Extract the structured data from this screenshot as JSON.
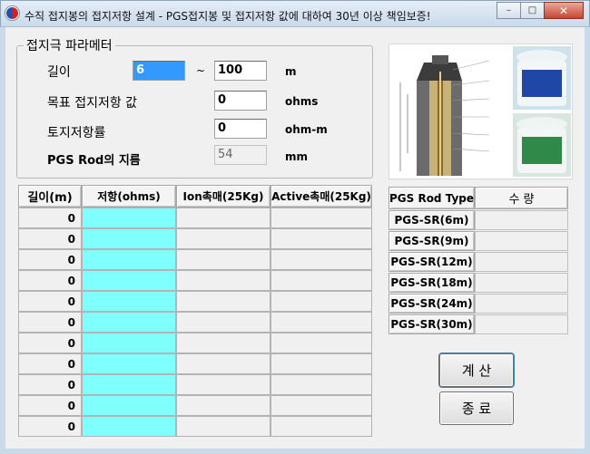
{
  "window": {
    "title": "수직 접지봉의 접지저항 설계 - PGS접지봉 및 접지저항 값에 대하여 30년 이상 책임보증!",
    "minimize": "–",
    "maximize": "□",
    "close": "✕"
  },
  "params": {
    "group_title": "접지극 파라메터",
    "depth_label": "길이",
    "depth_from": "6",
    "depth_sep": "~",
    "depth_to": "100",
    "depth_unit": "m",
    "target_label": "목표 접지저항 값",
    "target_value": "0",
    "target_unit": "ohms",
    "soil_label": "토지저항률",
    "soil_value": "0",
    "soil_unit": "ohm-m",
    "rod_diam_label": "PGS Rod의 지름",
    "rod_diam_value": "54",
    "rod_diam_unit": "mm"
  },
  "result_table": {
    "headers": [
      "길이(m)",
      "저항(ohms)",
      "Ion촉매(25Kg)",
      "Active촉매(25Kg)"
    ],
    "rows": [
      {
        "depth": "0"
      },
      {
        "depth": "0"
      },
      {
        "depth": "0"
      },
      {
        "depth": "0"
      },
      {
        "depth": "0"
      },
      {
        "depth": "0"
      },
      {
        "depth": "0"
      },
      {
        "depth": "0"
      },
      {
        "depth": "0"
      },
      {
        "depth": "0"
      },
      {
        "depth": "0"
      }
    ]
  },
  "rod_table": {
    "headers": [
      "PGS Rod Type",
      "수  량"
    ],
    "rows": [
      "PGS-SR(6m)",
      "PGS-SR(9m)",
      "PGS-SR(12m)",
      "PGS-SR(18m)",
      "PGS-SR(24m)",
      "PGS-SR(30m)"
    ]
  },
  "buttons": {
    "calculate": "계  산",
    "exit": "종  료"
  },
  "colors": {
    "resistance_cell": "#80ffff",
    "selection": "#3399ff"
  }
}
